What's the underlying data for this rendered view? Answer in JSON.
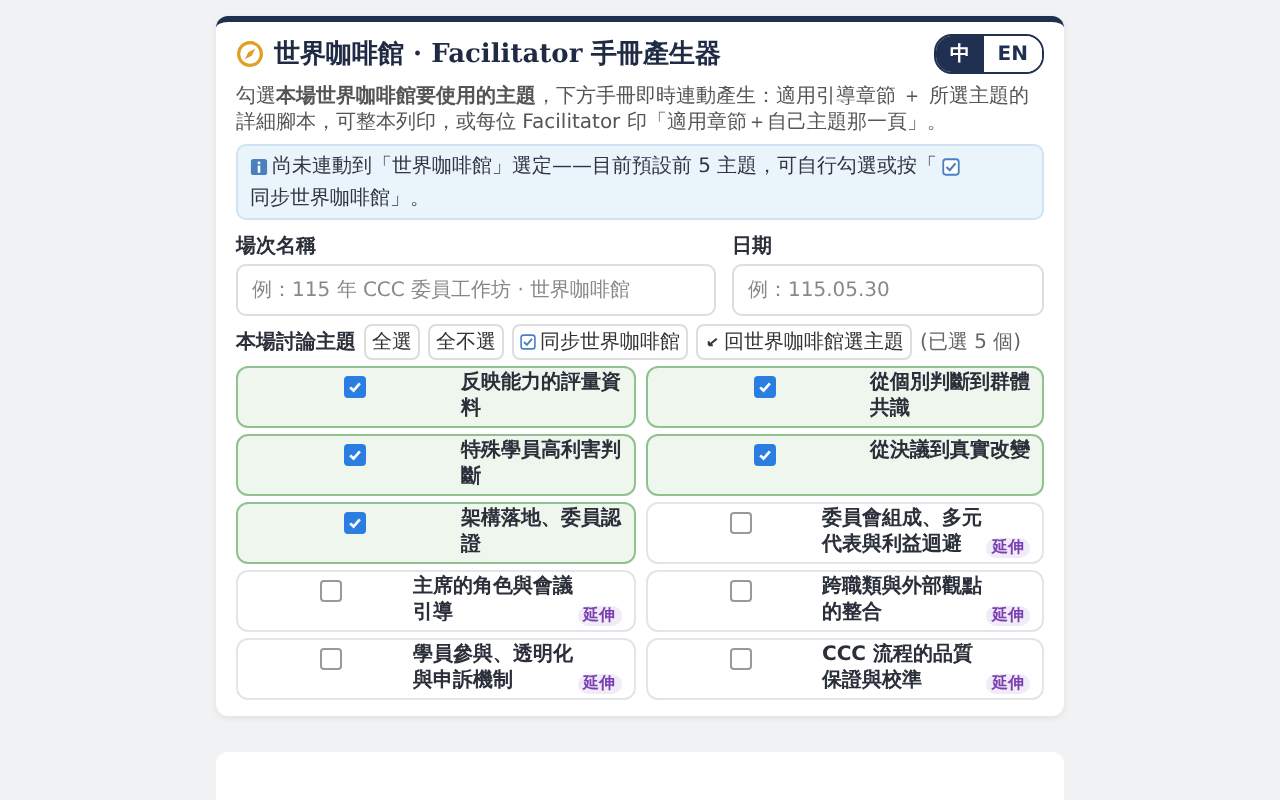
{
  "header": {
    "title": "世界咖啡館 · Facilitator 手冊產生器",
    "languages": [
      {
        "label": "中",
        "selected": true
      },
      {
        "label": "EN",
        "selected": false
      }
    ]
  },
  "description": "勾選**本場世界咖啡館要使用的主題**，下方手冊即時連動產生：適用引導章節 ＋ 所選主題的詳細腳本，可整本列印，或每位 Facilitator 印「適用章節＋自己主題那一頁」。",
  "notice": {
    "text_before": "尚未連動到「世界咖啡館」選定——目前預設前 5 主題，可自行勾選或按「",
    "text_after": "同步世界咖啡館」。"
  },
  "fields": [
    {
      "label": "場次名稱",
      "placeholder": "例：115 年 CCC 委員工作坊 · 世界咖啡館"
    },
    {
      "label": "日期",
      "placeholder": "例：115.05.30"
    }
  ],
  "topics_toolbar": {
    "label": "本場討論主題",
    "buttons": [
      {
        "label": "全選",
        "kind": "plain"
      },
      {
        "label": "全不選",
        "kind": "plain"
      },
      {
        "label": "同步世界咖啡館",
        "kind": "sync"
      },
      {
        "label": "回世界咖啡館選主題",
        "kind": "back"
      }
    ],
    "count": "(已選 5 個)"
  },
  "topics": [
    {
      "title": "反映能力的評量資料",
      "checked": true
    },
    {
      "title": "從個別判斷到群體共識",
      "checked": true
    },
    {
      "title": "特殊學員高利害判斷",
      "checked": true
    },
    {
      "title": "從決議到真實改變",
      "checked": true
    },
    {
      "title": "架構落地、委員認證",
      "checked": true
    },
    {
      "title": "委員會組成、多元代表與利益迴避",
      "checked": false,
      "badge": "延伸"
    },
    {
      "title": "主席的角色與會議引導",
      "checked": false,
      "badge": "延伸"
    },
    {
      "title": "跨職類與外部觀點的整合",
      "checked": false,
      "badge": "延伸"
    },
    {
      "title": "學員參與、透明化與申訴機制",
      "checked": false,
      "badge": "延伸"
    },
    {
      "title": "CCC 流程的品質保證與校準",
      "checked": false,
      "badge": "延伸"
    }
  ]
}
